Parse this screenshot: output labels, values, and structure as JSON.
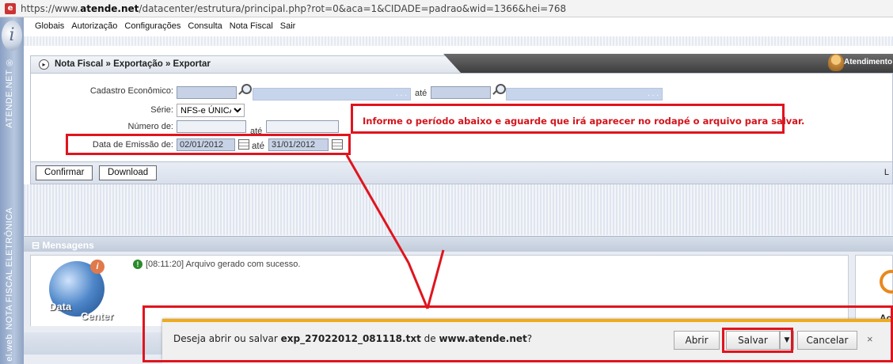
{
  "browser": {
    "url_prefix": "https://www.",
    "url_domain": "atende.net",
    "url_rest": "/datacenter/estrutura/principal.php?rot=0&aca=1&CIDADE=padrao&wid=1366&hei=768"
  },
  "sidebar": {
    "vertical_top": "ATENDE.NET ®",
    "vertical_mid": "NOTA FISCAL ELETRÔNICA",
    "vertical_bottom": "el.web",
    "logo_letter": "i"
  },
  "menu": {
    "items": [
      "Globais",
      "Autorização",
      "Configurações",
      "Consulta",
      "Nota Fiscal",
      "Sair"
    ]
  },
  "header": {
    "breadcrumb": "Nota Fiscal » Exportação » Exportar",
    "atendimento": "Atendimento"
  },
  "form": {
    "cadastro_label": "Cadastro Econômico:",
    "ate_label": "até",
    "serie_label": "Série:",
    "serie_value": "NFS-e ÚNICA",
    "numero_label": "Número de:",
    "data_label": "Data de Emissão de:",
    "data_from": "02/01/2012",
    "data_to": "31/01/2012",
    "dots": ". . ."
  },
  "buttons": {
    "confirmar": "Confirmar",
    "download": "Download",
    "right_letter": "L"
  },
  "messages": {
    "title": "Mensagens",
    "line": "[08:11:20] Arquivo gerado com sucesso.",
    "logo_data": "Data",
    "logo_center": "Center",
    "logo_badge": "i",
    "right_text": "Ac"
  },
  "annotation": {
    "note": "Informe o período abaixo e aguarde que irá aparecer no rodapé o arquivo para salvar."
  },
  "download_bar": {
    "prompt_prefix": "Deseja abrir ou salvar",
    "filename": "exp_27022012_081118.txt",
    "prompt_mid": "de",
    "site": "www.atende.net",
    "prompt_suffix": "?",
    "open": "Abrir",
    "save": "Salvar",
    "cancel": "Cancelar",
    "close": "×"
  },
  "colors": {
    "annotation_red": "#e0141e",
    "bar_orange": "#f0ab1c",
    "field_blue": "#c7d2e6"
  }
}
